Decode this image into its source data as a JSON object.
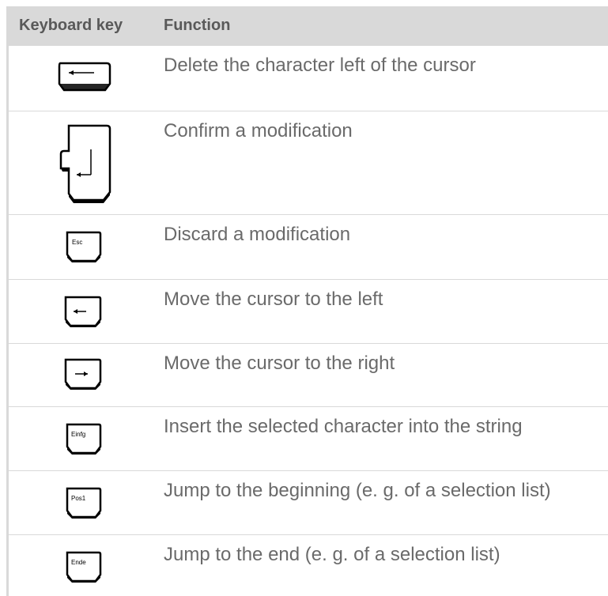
{
  "table": {
    "headers": {
      "key": "Keyboard key",
      "function": "Function"
    },
    "rows": [
      {
        "key_icon": "backspace-key-icon",
        "key_label": "",
        "function": "Delete the character left of the cursor"
      },
      {
        "key_icon": "enter-key-icon",
        "key_label": "",
        "function": "Confirm a modification"
      },
      {
        "key_icon": "esc-key-icon",
        "key_label": "Esc",
        "function": "Discard a modification"
      },
      {
        "key_icon": "arrow-left-key-icon",
        "key_label": "",
        "function": "Move the cursor to the left"
      },
      {
        "key_icon": "arrow-right-key-icon",
        "key_label": "",
        "function": "Move the cursor to the right"
      },
      {
        "key_icon": "insert-key-icon",
        "key_label": "Einfg",
        "function": "Insert the selected character into the string"
      },
      {
        "key_icon": "home-key-icon",
        "key_label": "Pos1",
        "function": "Jump to the beginning (e. g. of a selection list)"
      },
      {
        "key_icon": "end-key-icon",
        "key_label": "Ende",
        "function": "Jump to the end (e. g. of a selection list)"
      }
    ]
  },
  "colors": {
    "header_bg": "#d9d9d9",
    "header_text": "#595959",
    "body_text": "#6a6a6a",
    "border": "#d9d9d9"
  }
}
